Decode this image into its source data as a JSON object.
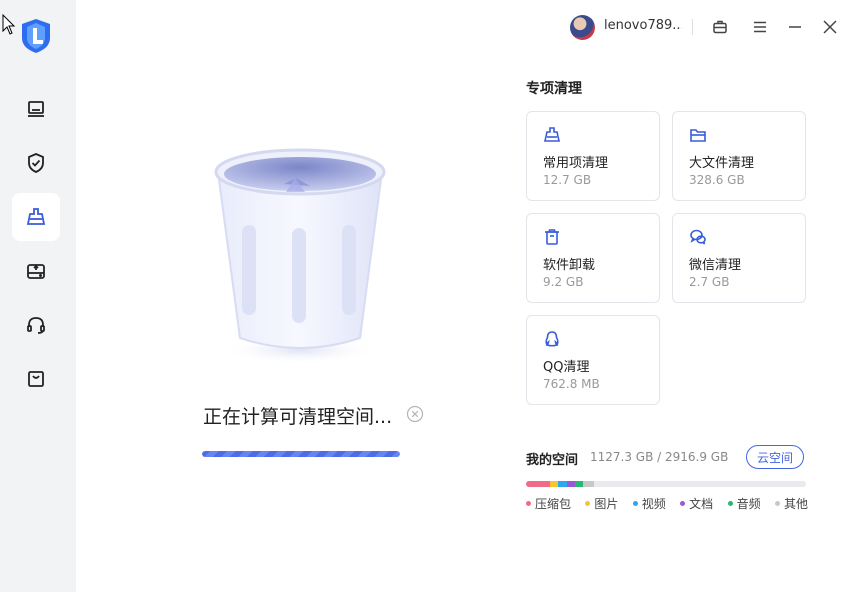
{
  "user": {
    "name": "lenovo789..."
  },
  "sidebar": {
    "items": [
      {
        "icon": "laptop-icon"
      },
      {
        "icon": "shield-check-icon"
      },
      {
        "icon": "broom-icon",
        "active": true
      },
      {
        "icon": "drive-upload-icon"
      },
      {
        "icon": "headset-icon"
      },
      {
        "icon": "bag-icon"
      }
    ]
  },
  "main": {
    "status": "正在计算可清理空间...",
    "progress": 1.0
  },
  "cleanup": {
    "title": "专项清理",
    "cards": [
      {
        "name": "常用项清理",
        "size": "12.7 GB",
        "icon": "broom-icon"
      },
      {
        "name": "大文件清理",
        "size": "328.6 GB",
        "icon": "folder-icon"
      },
      {
        "name": "软件卸载",
        "size": "9.2 GB",
        "icon": "trash-icon"
      },
      {
        "name": "微信清理",
        "size": "2.7 GB",
        "icon": "wechat-icon"
      },
      {
        "name": "QQ清理",
        "size": "762.8 MB",
        "icon": "qq-icon"
      }
    ]
  },
  "space": {
    "title": "我的空间",
    "value": "1127.3 GB / 2916.9 GB",
    "cloud_button": "云空间",
    "legend": [
      {
        "label": "压缩包",
        "color": "#f06b87"
      },
      {
        "label": "图片",
        "color": "#f7c531"
      },
      {
        "label": "视频",
        "color": "#2ea7f0"
      },
      {
        "label": "文档",
        "color": "#9b59d6"
      },
      {
        "label": "音频",
        "color": "#2bb673"
      },
      {
        "label": "其他",
        "color": "#c8c8c8"
      }
    ]
  }
}
